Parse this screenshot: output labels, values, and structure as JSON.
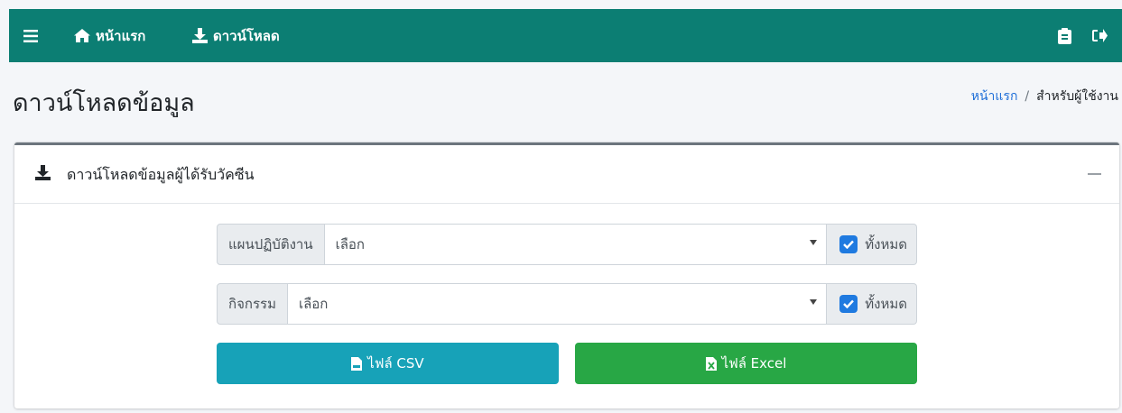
{
  "nav": {
    "home_label": "หน้าแรก",
    "download_label": "ดาวน์โหลด",
    "icons": {
      "menu": "hamburger-icon",
      "home": "home-icon",
      "download": "download-icon",
      "clipboard": "clipboard-icon",
      "logout": "logout-icon"
    }
  },
  "page": {
    "title": "ดาวน์โหลดข้อมูล"
  },
  "breadcrumb": {
    "home": "หน้าแรก",
    "separator": "/",
    "current": "สำหรับผู้ใช้งาน"
  },
  "card": {
    "title": "ดาวน์โหลดข้อมูลผู้ได้รับวัคซีน",
    "plan": {
      "label": "แผนปฏิบัติงาน",
      "selected": "เลือก",
      "all_label": "ทั้งหมด",
      "all_checked": true
    },
    "activity": {
      "label": "กิจกรรม",
      "selected": "เลือก",
      "all_label": "ทั้งหมด",
      "all_checked": true
    },
    "csv_button": "ไฟล์ CSV",
    "excel_button": "ไฟล์ Excel"
  },
  "colors": {
    "navbar": "#0c7e73",
    "csv_button": "#17a2b8",
    "excel_button": "#28a745",
    "checkbox": "#1f7ae0",
    "link": "#1f6fd8"
  }
}
